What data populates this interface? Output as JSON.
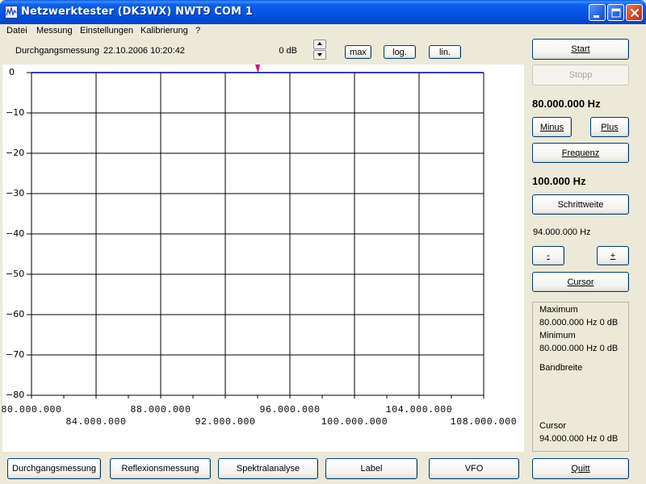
{
  "window": {
    "title": "Netzwerktester (DK3WX) NWT9    COM 1"
  },
  "menu": {
    "items": [
      {
        "label": "Datei"
      },
      {
        "label": "Messung"
      },
      {
        "label": "Einstellungen"
      },
      {
        "label": "Kalibrierung"
      },
      {
        "label": "?"
      }
    ]
  },
  "toolbar": {
    "mode": "Durchgangsmessung",
    "datetime": "22.10.2006  10:20:42",
    "db_value": "0 dB",
    "max_label": "max",
    "log_label": "log.",
    "lin_label": "lin."
  },
  "chart_data": {
    "type": "line",
    "y_ticks": [
      "0",
      "-10",
      "-20",
      "-30",
      "-40",
      "-50",
      "-60",
      "-70",
      "-80"
    ],
    "x_ticks_upper": [
      "80.000.000",
      "88.000.000",
      "96.000.000",
      "104.000.000"
    ],
    "x_ticks_lower": [
      "84.000.000",
      "92.000.000",
      "100.000.000",
      "108.000.000"
    ],
    "xlim": [
      80000000,
      108000000
    ],
    "ylim": [
      -80,
      0
    ],
    "grid": true,
    "series": [
      {
        "x": [
          80000000,
          108000000
        ],
        "y": [
          0,
          0
        ],
        "color": "#000080"
      }
    ],
    "marker_x": 94000000,
    "marker_color": "#e0007f"
  },
  "right_panel": {
    "start_label": "Start",
    "stopp_label": "Stopp",
    "frequency": "80.000.000 Hz",
    "minus_label": "Minus",
    "plus_label": "Plus",
    "frequenz_label": "Frequenz",
    "step": "100.000 Hz",
    "schrittweite_label": "Schrittweite",
    "cursor_freq": "94.000.000 Hz",
    "dec_label": "-",
    "inc_label": "+",
    "cursor_label": "Cursor"
  },
  "info": {
    "maximum_label": "Maximum",
    "maximum_value": "80.000.000 Hz 0 dB",
    "minimum_label": "Minimum",
    "minimum_value": "80.000.000 Hz 0 dB",
    "bandbreite_label": "Bandbreite",
    "cursor_label": "Cursor",
    "cursor_value": "94.000.000 Hz 0 dB"
  },
  "bottom_bar": {
    "durchgang_label": "Durchgangsmessung",
    "reflexion_label": "Reflexionsmessung",
    "spektral_label": "Spektralanalyse",
    "label_label": "Label",
    "vfo_label": "VFO",
    "quit_label": "Quitt"
  }
}
